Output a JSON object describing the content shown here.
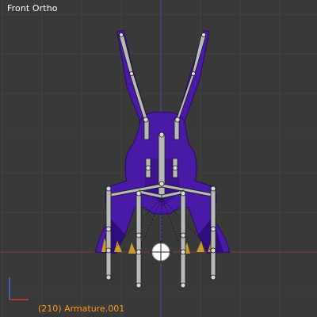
{
  "viewport": {
    "view_name": "Front Ortho",
    "status": "(210) Armature.001",
    "colors": {
      "background": "#393939",
      "grid_line": "#424242",
      "x_axis": "#8b3a3a",
      "z_axis": "#4a4aa8",
      "mesh_fill": "#4a1aa6",
      "mesh_dark": "#2a0a6a",
      "bone": "#b9b9b9",
      "bone_outline": "#1a1a1a",
      "claw": "#c89a2a",
      "status_text": "#ff9a1a"
    },
    "gizmo": {
      "axes": [
        "z-axis-icon",
        "x-axis-icon"
      ]
    }
  }
}
